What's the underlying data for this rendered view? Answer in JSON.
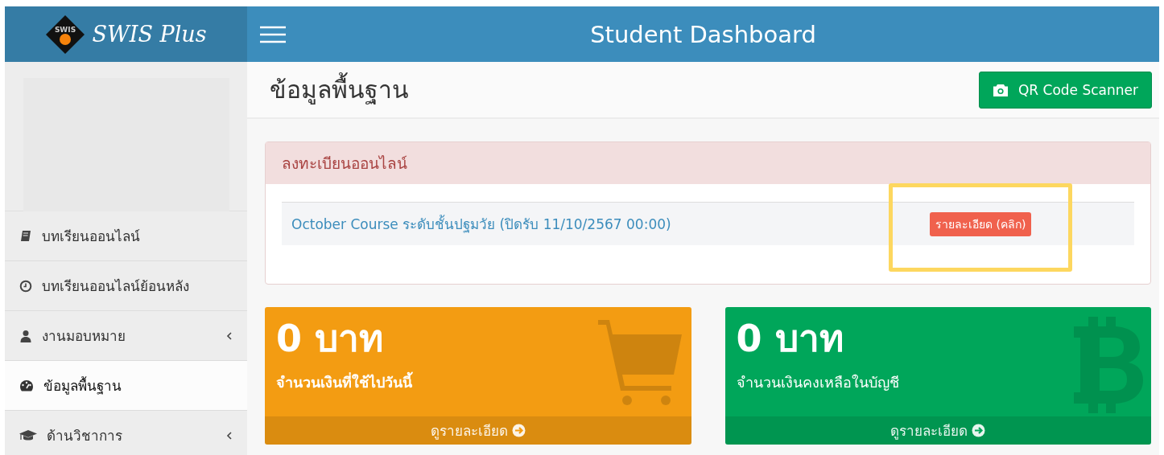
{
  "header": {
    "logo_badge": "SWIS",
    "logo_text": "SWIS Plus",
    "title": "Student Dashboard"
  },
  "sidebar": {
    "items": [
      {
        "label": "บทเรียนออนไลน์",
        "kind": "book",
        "selected": false,
        "expandable": false
      },
      {
        "label": "บทเรียนออนไลน์ย้อนหลัง",
        "kind": "clock",
        "selected": false,
        "expandable": false
      },
      {
        "label": "งานมอบหมาย",
        "kind": "user",
        "selected": false,
        "expandable": true
      },
      {
        "label": "ข้อมูลพื้นฐาน",
        "kind": "dashboard",
        "selected": true,
        "expandable": false
      },
      {
        "label": "ด้านวิชาการ",
        "kind": "graduation",
        "selected": false,
        "expandable": true
      }
    ]
  },
  "page": {
    "title": "ข้อมูลพื้นฐาน",
    "action_button": "QR Code Scanner"
  },
  "registration_panel": {
    "title": "ลงทะเบียนออนไลน์",
    "rows": [
      {
        "course": "October Course ระดับชั้นปฐมวัย (ปิดรับ 11/10/2567 00:00)",
        "action": "รายละเอียด (คลิก)",
        "highlighted": true
      }
    ]
  },
  "stat_cards": [
    {
      "kind": "cart",
      "amount": "0 บาท",
      "label": "จำนวนเงินที่ใช้ไปวันนี้",
      "emphasized": true,
      "link": "ดูรายละเอียด",
      "color": "#f39c12"
    },
    {
      "kind": "coin",
      "amount": "0 บาท",
      "label": "จำนวนเงินคงเหลือในบัญชี",
      "emphasized": false,
      "link": "ดูรายละเอียด",
      "color": "#00a65a"
    }
  ]
}
